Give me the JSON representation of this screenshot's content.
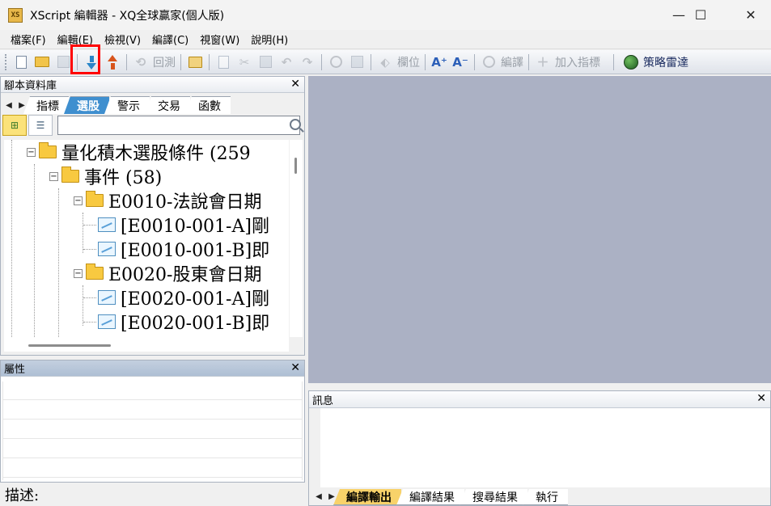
{
  "window": {
    "icon_text": "XS",
    "title": "XScript 編輯器 - XQ全球贏家(個人版)",
    "minimize": "—",
    "maximize": "☐",
    "close": "✕"
  },
  "menu": [
    "檔案(F)",
    "編輯(E)",
    "檢視(V)",
    "編譯(C)",
    "視窗(W)",
    "說明(H)"
  ],
  "toolbar": {
    "backtest_label": "回測",
    "field_label": "欄位",
    "compile_label": "編譯",
    "add_indicator_label": "加入指標",
    "strategy_radar_label": "策略雷達",
    "highlighted_button": "download-button"
  },
  "library": {
    "title": "腳本資料庫",
    "close": "✕",
    "tabs": [
      "指標",
      "選股",
      "警示",
      "交易",
      "函數"
    ],
    "selected_tab": "選股",
    "search_value": "",
    "tree": [
      {
        "label": "量化積木選股條件 (259",
        "kind": "folder",
        "expanded": true,
        "level": 0
      },
      {
        "label": "事件 (58)",
        "kind": "folder",
        "expanded": true,
        "level": 1
      },
      {
        "label": "E0010-法說會日期",
        "kind": "folder",
        "expanded": true,
        "level": 2
      },
      {
        "label": "[E0010-001-A]剛",
        "kind": "script",
        "level": 3
      },
      {
        "label": "[E0010-001-B]即",
        "kind": "script",
        "level": 3
      },
      {
        "label": "E0020-股東會日期",
        "kind": "folder",
        "expanded": true,
        "level": 2
      },
      {
        "label": "[E0020-001-A]剛",
        "kind": "script",
        "level": 3
      },
      {
        "label": "[E0020-001-B]即",
        "kind": "script",
        "level": 3
      }
    ]
  },
  "properties": {
    "title": "屬性",
    "close": "✕",
    "description_label": "描述:"
  },
  "messages": {
    "title": "訊息",
    "close": "✕",
    "tabs": [
      "編譯輸出",
      "編譯結果",
      "搜尋結果",
      "執行"
    ],
    "selected_tab": "編譯輸出"
  },
  "colors": {
    "selected_tab": "#3f8fcf",
    "editor_background": "#abb1c4",
    "highlight_box": "#ff0000",
    "output_tab": "#f8d26a"
  }
}
